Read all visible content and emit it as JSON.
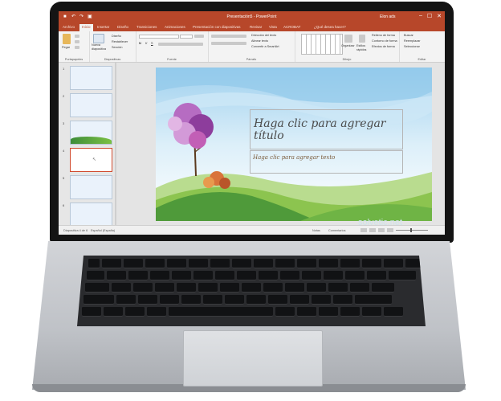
{
  "window": {
    "title": "Presentación5 - PowerPoint",
    "user": "Elon ads",
    "minimize": "–",
    "maximize": "☐",
    "close": "✕"
  },
  "ribbon_tabs": [
    {
      "label": "Archivo"
    },
    {
      "label": "Inicio"
    },
    {
      "label": "Insertar"
    },
    {
      "label": "Diseño"
    },
    {
      "label": "Transiciones"
    },
    {
      "label": "Animaciones"
    },
    {
      "label": "Presentación con diapositivas"
    },
    {
      "label": "Revisar"
    },
    {
      "label": "Vista"
    },
    {
      "label": "ACROBAT"
    },
    {
      "label": "¿Qué desea hacer?"
    }
  ],
  "ribbon": {
    "paste": "Pegar",
    "new_slide": "Nueva diapositiva",
    "layout": "Diseño",
    "reset": "Restablecer",
    "section": "Sección",
    "text_direction": "Dirección del texto",
    "align_text": "Alinear texto",
    "convert_smartart": "Convertir a SmartArt",
    "arrange": "Organizar",
    "quick_styles": "Estilos rápidos",
    "shape_fill": "Relleno de forma",
    "shape_outline": "Contorno de forma",
    "shape_effects": "Efectos de forma",
    "find": "Buscar",
    "replace": "Reemplazar",
    "select": "Seleccionar",
    "groups": {
      "clipboard": "Portapapeles",
      "slides": "Diapositivas",
      "font": "Fuente",
      "paragraph": "Párrafo",
      "drawing": "Dibujo",
      "editing": "Editar"
    }
  },
  "thumbnails": [
    {
      "num": "1"
    },
    {
      "num": "2"
    },
    {
      "num": "3"
    },
    {
      "num": "4"
    },
    {
      "num": "5"
    },
    {
      "num": "6"
    }
  ],
  "slide": {
    "title_placeholder": "Haga clic para agregar título",
    "subtitle_placeholder": "Haga clic para agregar texto"
  },
  "watermark": "solvetic.net",
  "status": {
    "slide_count": "Diapositiva 4 de 6",
    "language": "Español (España)",
    "notes": "Notas",
    "comments": "Comentarios"
  },
  "colors": {
    "accent": "#b7472a",
    "slide_sky": "#bfe0f3",
    "slide_grass": "#5aa83a"
  }
}
